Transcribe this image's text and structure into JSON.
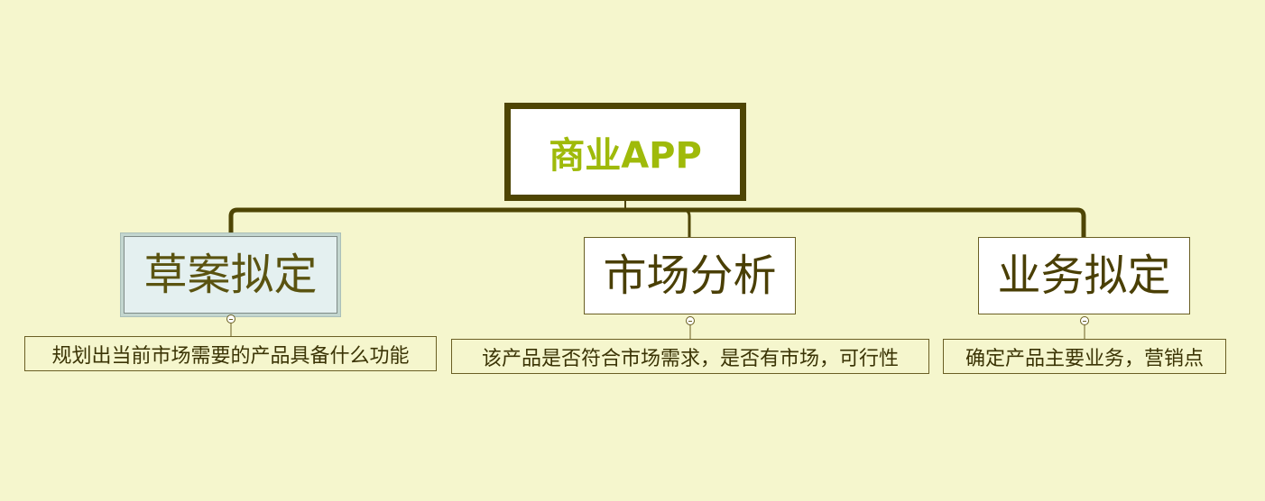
{
  "mindmap": {
    "root": {
      "label": "商业APP",
      "color": "#9fba0a"
    },
    "branches": [
      {
        "label": "草案拟定",
        "selected": true,
        "note": "规划出当前市场需要的产品具备什么功能"
      },
      {
        "label": "市场分析",
        "selected": false,
        "note": "该产品是否符合市场需求，是否有市场，可行性"
      },
      {
        "label": "业务拟定",
        "selected": false,
        "note": "确定产品主要业务，营销点"
      }
    ],
    "colors": {
      "background": "#f5f6cd",
      "line": "#4e4504",
      "selected_fill": "#e4f0f0"
    }
  }
}
